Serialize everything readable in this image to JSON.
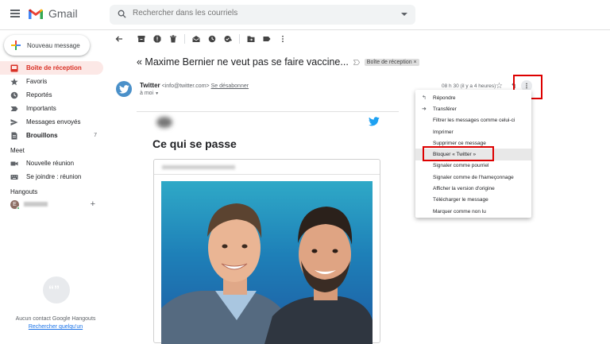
{
  "app": {
    "name": "Gmail"
  },
  "search": {
    "placeholder": "Rechercher dans les courriels"
  },
  "sidebar": {
    "compose_label": "Nouveau message",
    "items": [
      {
        "label": "Boîte de réception",
        "icon": "inbox-icon",
        "active": true
      },
      {
        "label": "Favoris",
        "icon": "star-icon"
      },
      {
        "label": "Reportés",
        "icon": "clock-icon"
      },
      {
        "label": "Importants",
        "icon": "important-icon"
      },
      {
        "label": "Messages envoyés",
        "icon": "send-icon"
      },
      {
        "label": "Brouillons",
        "icon": "draft-icon",
        "count": "7"
      }
    ],
    "meet_title": "Meet",
    "meet_items": [
      {
        "label": "Nouvelle réunion",
        "icon": "video-icon"
      },
      {
        "label": "Se joindre : réunion",
        "icon": "keyboard-icon"
      }
    ],
    "hangouts_title": "Hangouts",
    "hangouts_user_initial": "E",
    "no_contact_text": "Aucun contact Google Hangouts",
    "search_someone": "Rechercher quelqu'un"
  },
  "email": {
    "subject": "« Maxime Bernier ne veut pas se faire vaccine...",
    "label_tag": "Boîte de réception ×",
    "sender_name": "Twitter",
    "sender_address": "<info@twitter.com>",
    "unsubscribe": "Se désabonner",
    "to_me": "à moi",
    "time": "08 h 30 (il y a 4 heures)",
    "headline": "Ce qui se passe"
  },
  "menu": {
    "items": [
      {
        "label": "Répondre",
        "icon": "reply-icon"
      },
      {
        "label": "Transférer",
        "icon": "forward-icon"
      },
      {
        "label": "Filtrer les messages comme celui-ci"
      },
      {
        "label": "Imprimer"
      },
      {
        "label": "Supprimer ce message"
      },
      {
        "label": "Bloquer « Twitter »",
        "hover": true
      },
      {
        "label": "Signaler comme pourriel"
      },
      {
        "label": "Signaler comme de l'hameçonnage"
      },
      {
        "label": "Afficher la version d'origine"
      },
      {
        "label": "Télécharger le message"
      },
      {
        "label": "Marquer comme non lu"
      }
    ]
  },
  "colors": {
    "accent_red": "#d93025",
    "active_bg": "#fce8e6",
    "twitter_blue": "#1da1f2",
    "highlight": "#dd0000"
  }
}
